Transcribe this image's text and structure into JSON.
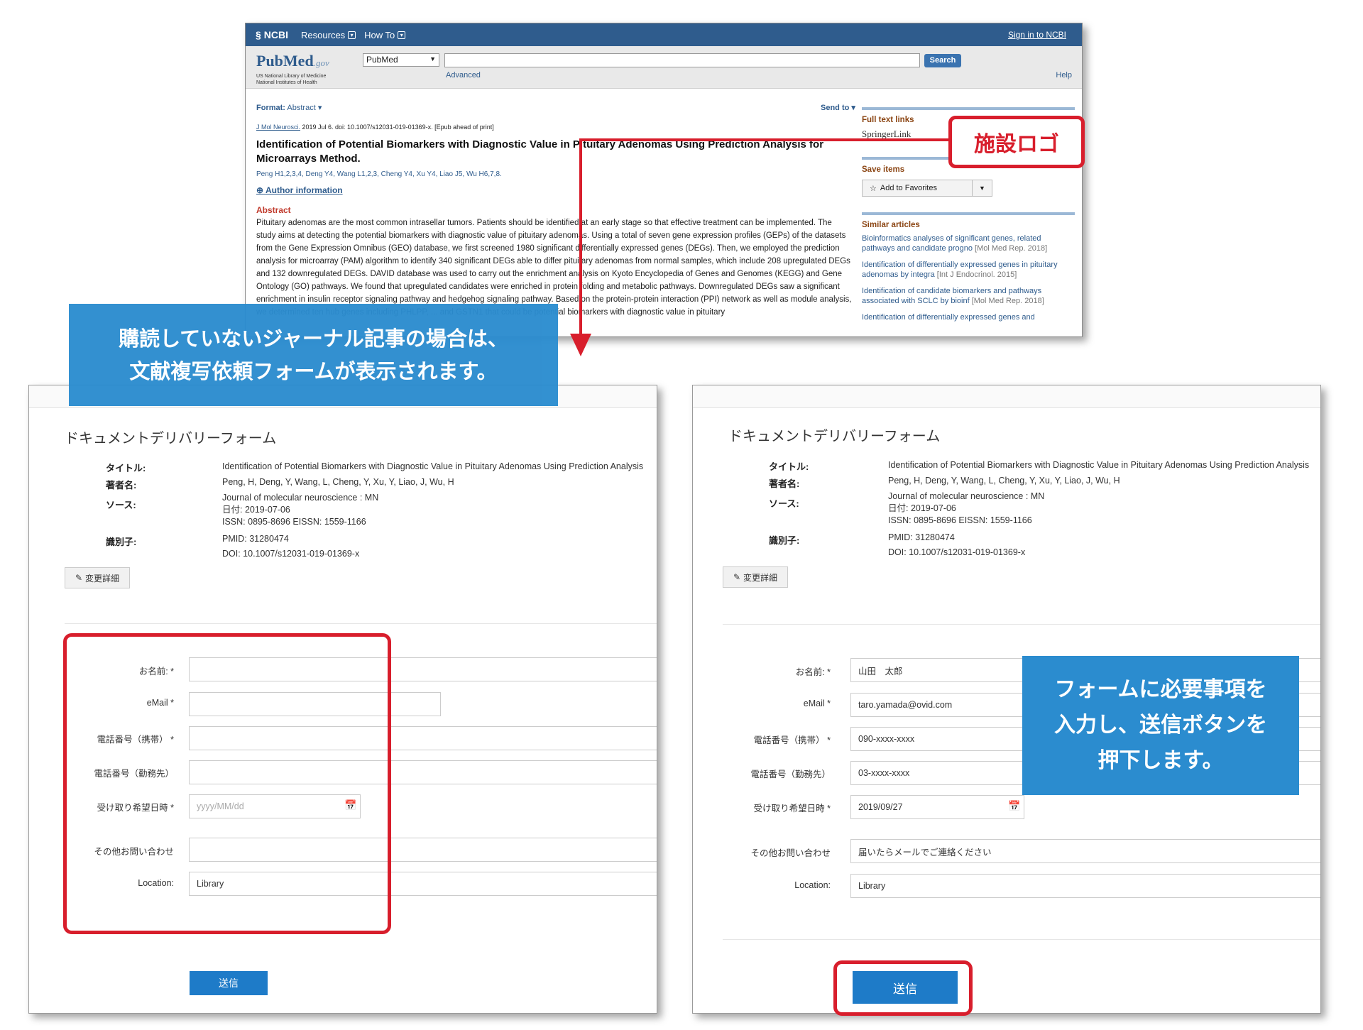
{
  "pubmed": {
    "topbar": {
      "ncbi": "NCBI",
      "resources": "Resources",
      "howto": "How To",
      "signin": "Sign in to NCBI"
    },
    "logo": {
      "main": "PubMed",
      "gov": ".gov",
      "sub1": "US National Library of Medicine",
      "sub2": "National Institutes of Health"
    },
    "db_select": "PubMed",
    "search_button": "Search",
    "advanced": "Advanced",
    "help": "Help",
    "format_label": "Format:",
    "format_value": "Abstract",
    "send_to": "Send to",
    "citation_journal": "J Mol Neurosci.",
    "citation_rest": " 2019 Jul 6. doi: 10.1007/s12031-019-01369-x. [Epub ahead of print]",
    "article_title": "Identification of Potential Biomarkers with Diagnostic Value in Pituitary Adenomas Using Prediction Analysis for Microarrays Method.",
    "authors": "Peng H1,2,3,4, Deng Y4, Wang L1,2,3, Cheng Y4, Xu Y4, Liao J5, Wu H6,7,8.",
    "author_info": "Author information",
    "abstract_heading": "Abstract",
    "abstract_text": "Pituitary adenomas are the most common intrasellar tumors. Patients should be identified at an early stage so that effective treatment can be implemented. The study aims at detecting the potential biomarkers with diagnostic value of pituitary adenomas. Using a total of seven gene expression profiles (GEPs) of the datasets from the Gene Expression Omnibus (GEO) database, we first screened 1980 significant differentially expressed genes (DEGs). Then, we employed the prediction analysis for microarray (PAM) algorithm to identify 340 significant DEGs able to differ pituitary adenomas from normal samples, which include 208 upregulated DEGs and 132 downregulated DEGs. DAVID database was used to carry out the enrichment analysis on Kyoto Encyclopedia of Genes and Genomes (KEGG) and Gene Ontology (GO) pathways. We found that upregulated candidates were enriched in protein folding and metabolic pathways. Downregulated DEGs saw a significant enrichment in insulin receptor signaling pathway and hedgehog signaling pathway. Based on the protein-protein interaction (PPI) network as well as module analysis, we determined ten hub genes including PHLPP, ... and GSTN1 that could be potential biomarkers with diagnostic value in pituitary",
    "side": {
      "fulltext_heading": "Full text links",
      "springer": "SpringerLink",
      "save_heading": "Save items",
      "add_fav": "Add to Favorites",
      "similar_heading": "Similar articles",
      "similar": [
        {
          "text": "Bioinformatics analyses of significant genes, related pathways and candidate progno",
          "src": " [Mol Med Rep. 2018]"
        },
        {
          "text": "Identification of differentially expressed genes in pituitary adenomas by integra",
          "src": " [Int J Endocrinol. 2015]"
        },
        {
          "text": "Identification of candidate biomarkers and pathways associated with SCLC by bioinf",
          "src": " [Mol Med Rep. 2018]"
        },
        {
          "text": "Identification of differentially expressed genes and",
          "src": ""
        }
      ]
    }
  },
  "callouts": {
    "logo": "施設ロゴ",
    "left_line1": "購読していないジャーナル記事の場合は、",
    "left_line2": "文献複写依頼フォームが表示されます。",
    "right_line1": "フォームに必要事項を",
    "right_line2": "入力し、送信ボタンを",
    "right_line3": "押下します。"
  },
  "form": {
    "title": "ドキュメントデリバリーフォーム",
    "labels": {
      "title": "タイトル:",
      "authors": "著者名:",
      "source": "ソース:",
      "identifier": "識別子:"
    },
    "values": {
      "title": "Identification of Potential Biomarkers with Diagnostic Value in Pituitary Adenomas Using Prediction Analysis",
      "authors": "Peng, H, Deng, Y, Wang, L, Cheng, Y, Xu, Y, Liao, J, Wu, H",
      "journal": "Journal of molecular neuroscience : MN",
      "date": "日付:    2019-07-06",
      "issn": "ISSN:    0895-8696    EISSN:    1559-1166",
      "pmid": "PMID: 31280474",
      "doi": "DOI: 10.1007/s12031-019-01369-x"
    },
    "edit_button": "変更詳細",
    "fields": {
      "name": "お名前: *",
      "email": "eMail *",
      "mobile": "電話番号（携帯） *",
      "work": "電話番号（勤務先）",
      "pickup": "受け取り希望日時 *",
      "other": "その他お問い合わせ",
      "location": "Location:"
    },
    "date_placeholder": "yyyy/MM/dd",
    "location_value": "Library",
    "submit": "送信"
  },
  "filled": {
    "name": "山田　太郎",
    "email": "taro.yamada@ovid.com",
    "mobile": "090-xxxx-xxxx",
    "work": "03-xxxx-xxxx",
    "pickup": "2019/09/27",
    "other": "届いたらメールでご連絡ください",
    "location": "Library"
  },
  "colors": {
    "ncbi_blue": "#2f5c8d",
    "annotation_red": "#d81e2c",
    "callout_blue": "#2b8ccf",
    "submit_blue": "#1e7bc8"
  }
}
